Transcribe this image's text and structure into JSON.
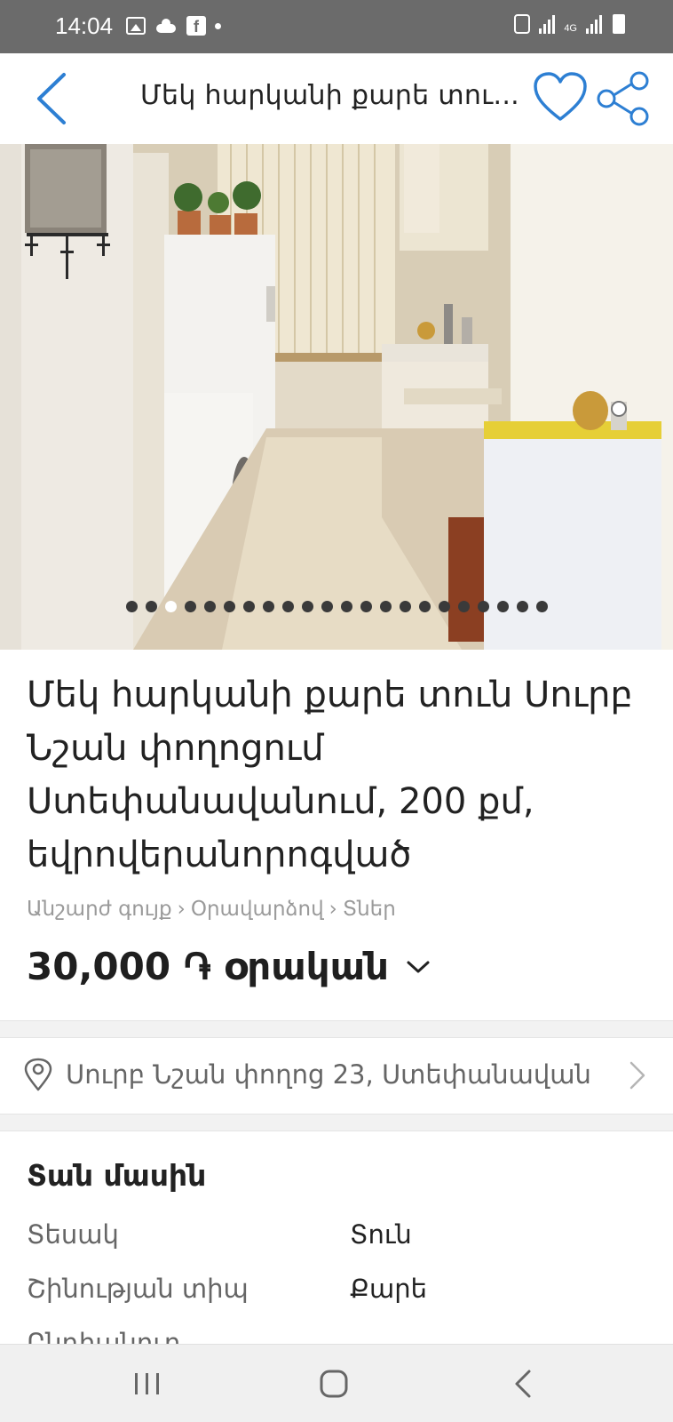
{
  "status_bar": {
    "time": "14:04",
    "left_icons": [
      "image-icon",
      "weather-icon",
      "facebook-icon",
      "dot-icon"
    ],
    "right_icons": [
      "recycle-icon",
      "signal-icon",
      "4g-icon",
      "signal-icon",
      "battery-icon"
    ],
    "network_label": "4G"
  },
  "header": {
    "title": "Մեկ հարկանի քարե տու...",
    "back_icon": "chevron-left-icon",
    "favorite_icon": "heart-icon",
    "share_icon": "share-icon"
  },
  "gallery": {
    "photo_count": 22,
    "active_index": 2
  },
  "listing": {
    "title": "Մեկ հարկանի քարե տուն Սուրբ Նշան փողոցում Ստեփանավանում, 200 քմ, եվրովերանորոգված",
    "breadcrumb": [
      "Անշարժ գույք",
      "›",
      "Օրավարձով",
      "›",
      "Տներ"
    ],
    "price": "30,000 ֏ օրական"
  },
  "location": {
    "address": "Սուրբ Նշան փողոց 23, Ստեփանավան"
  },
  "about": {
    "heading": "Տան մասին",
    "rows": [
      {
        "key": "Տեսակ",
        "value": "Տուն"
      },
      {
        "key": "Շինության տիպ",
        "value": "Քարե"
      },
      {
        "key": "Ընդհանուր",
        "value": ""
      }
    ]
  },
  "colors": {
    "accent": "#2d7fd3",
    "status_bar": "#6b6b6b",
    "nav_bar": "#f0f0f0"
  }
}
